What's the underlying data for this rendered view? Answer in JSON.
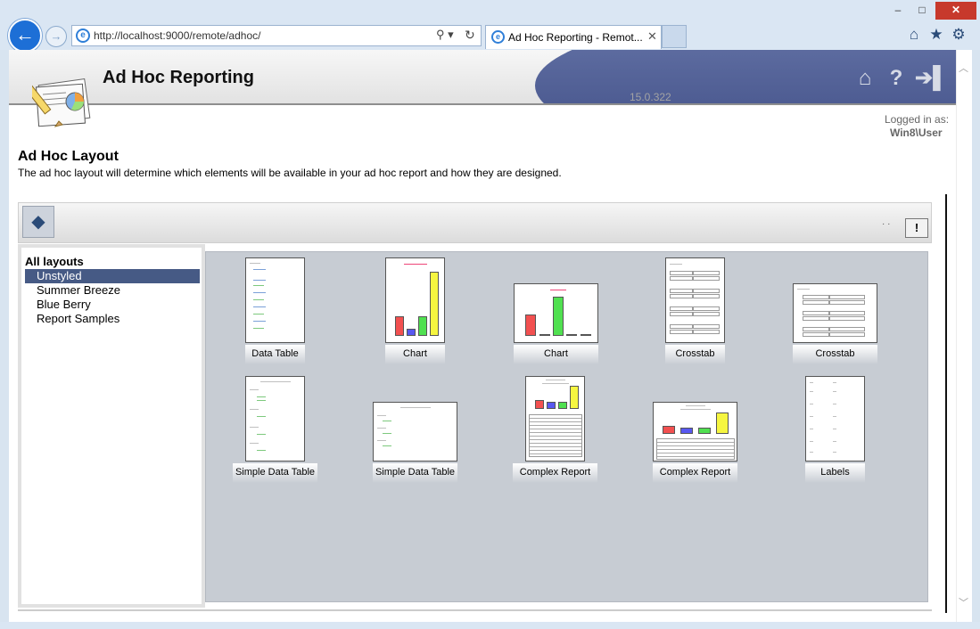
{
  "browser": {
    "back_glyph": "←",
    "forward_glyph": "→",
    "url": "http://localhost:9000/remote/adhoc/",
    "tab_title": "Ad Hoc Reporting - Remot...",
    "tab_close": "✕",
    "search_glyph": "⚲ ▾",
    "refresh_glyph": "↻",
    "home_glyph": "⌂",
    "fav_glyph": "★",
    "gear_glyph": "⚙",
    "minimize": "–",
    "maximize": "□",
    "close": "✕"
  },
  "app": {
    "title": "Ad Hoc Reporting",
    "version": "15.0.322",
    "logged_in_label": "Logged in as:",
    "logged_in_user": "Win8\\User",
    "help_glyph": "?",
    "home_glyph": "⌂",
    "logout_glyph": "➔▌"
  },
  "layout": {
    "title": "Ad Hoc Layout",
    "description": "The ad hoc layout will determine which elements will be available in your ad hoc report and how they are designed.",
    "info_glyph": "!",
    "dots": "· ·"
  },
  "sidebar": {
    "title": "All layouts",
    "items": [
      {
        "label": "Unstyled",
        "selected": true
      },
      {
        "label": "Summer Breeze",
        "selected": false
      },
      {
        "label": "Blue Berry",
        "selected": false
      },
      {
        "label": "Report Samples",
        "selected": false
      }
    ]
  },
  "layouts": [
    {
      "label": "Data Table"
    },
    {
      "label": "Chart"
    },
    {
      "label": "Chart"
    },
    {
      "label": "Crosstab"
    },
    {
      "label": "Crosstab"
    },
    {
      "label": "Simple Data Table"
    },
    {
      "label": "Simple Data Table"
    },
    {
      "label": "Complex Report"
    },
    {
      "label": "Complex Report"
    },
    {
      "label": "Labels"
    }
  ],
  "colors": {
    "selection": "#465a85",
    "header_wave": "#4a5890",
    "bar_red": "#f25050",
    "bar_blue": "#5858f0",
    "bar_green": "#50e050",
    "bar_yellow": "#f6f640"
  }
}
